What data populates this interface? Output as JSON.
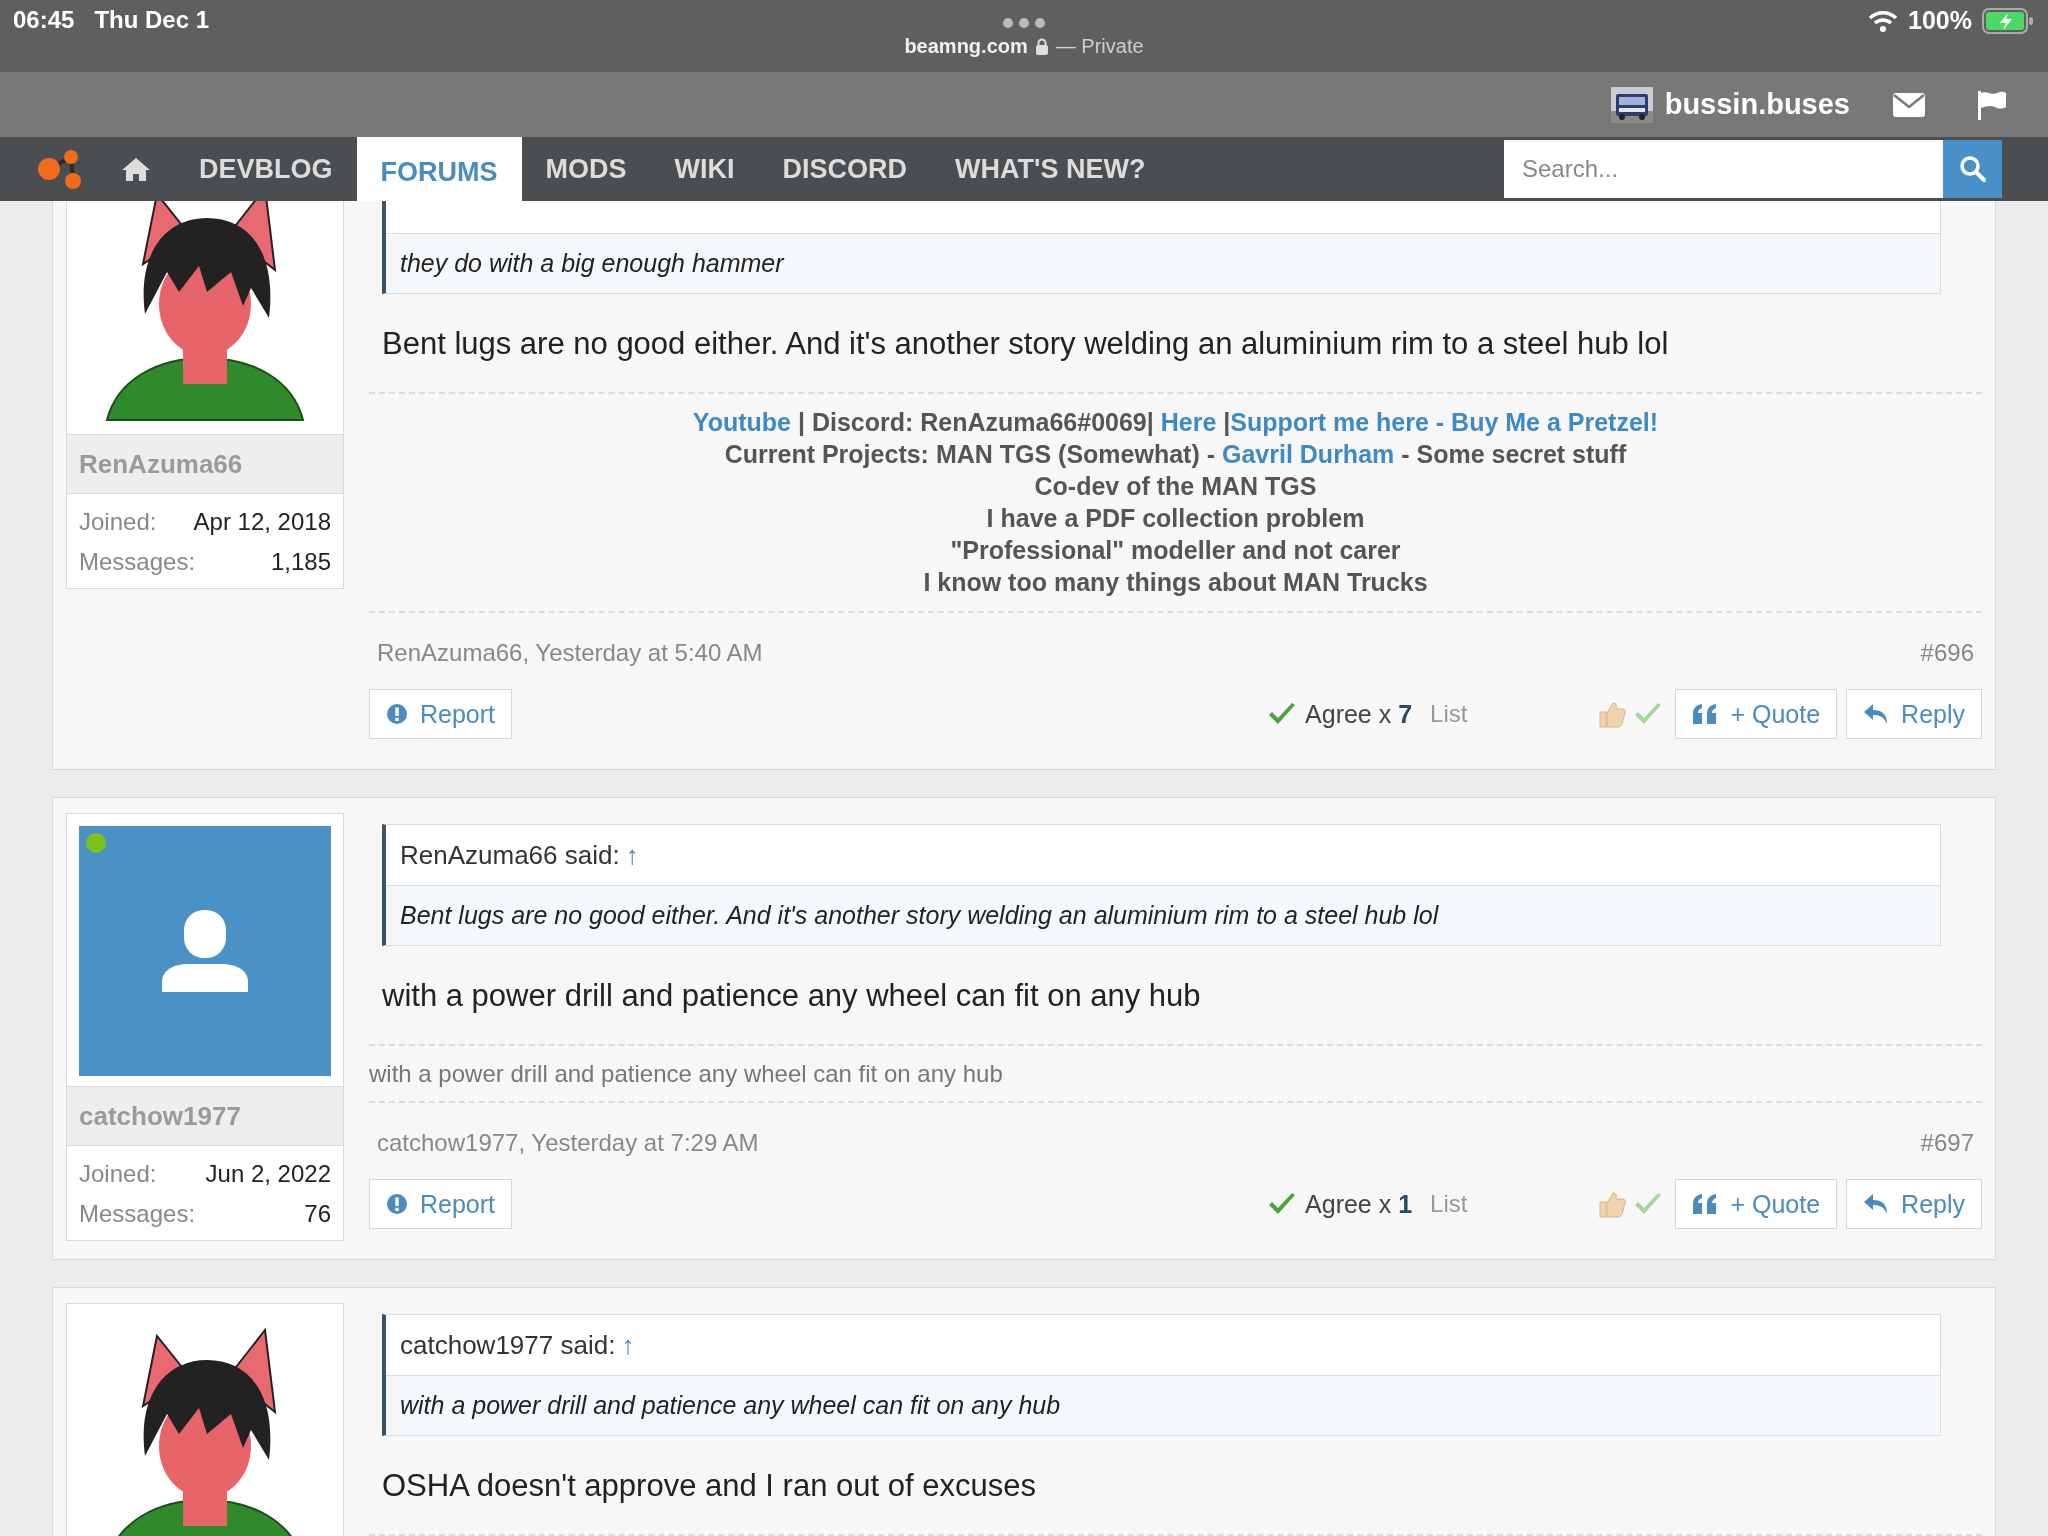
{
  "status_bar": {
    "time": "06:45",
    "date": "Thu Dec 1",
    "url": "beamng.com",
    "private_label": "— Private",
    "battery": "100%"
  },
  "user_bar": {
    "username": "bussin.buses"
  },
  "nav": {
    "items": [
      {
        "label": "DEVBLOG",
        "selected": false
      },
      {
        "label": "FORUMS",
        "selected": true
      },
      {
        "label": "MODS",
        "selected": false
      },
      {
        "label": "WIKI",
        "selected": false
      },
      {
        "label": "DISCORD",
        "selected": false
      },
      {
        "label": "WHAT'S NEW?",
        "selected": false
      }
    ],
    "search": {
      "placeholder": "Search..."
    }
  },
  "posts": [
    {
      "avatar": {
        "kind": "drawing"
      },
      "author": "RenAzuma66",
      "joined_label": "Joined:",
      "joined": "Apr 12, 2018",
      "messages_label": "Messages:",
      "messages": "1,185",
      "quote": {
        "text": "they do with a big enough hammer"
      },
      "body": "Bent lugs are no good either. And it's another story welding an aluminium rim to a steel hub lol",
      "signature": {
        "kind": "centered",
        "lines": [
          [
            {
              "kind": "link",
              "text": "Youtube"
            },
            {
              "kind": "text",
              "text": " | Discord: RenAzuma66#0069| "
            },
            {
              "kind": "link",
              "text": "Here"
            },
            {
              "kind": "text",
              "text": " |"
            },
            {
              "kind": "link",
              "text": "Support me here - Buy Me a Pretzel!"
            }
          ],
          [
            {
              "kind": "text",
              "text": "Current Projects: MAN TGS (Somewhat) - "
            },
            {
              "kind": "link",
              "text": "Gavril Durham"
            },
            {
              "kind": "text",
              "text": " - Some secret stuff"
            }
          ],
          [
            {
              "kind": "text",
              "text": "Co-dev of the MAN TGS"
            }
          ],
          [
            {
              "kind": "text",
              "text": "I have a PDF collection problem"
            }
          ],
          [
            {
              "kind": "text",
              "text": "\"Professional\" modeller and not carer"
            }
          ],
          [
            {
              "kind": "text",
              "text": "I know too many things about MAN Trucks"
            }
          ]
        ]
      },
      "meta": "RenAzuma66, Yesterday at 5:40 AM",
      "number": "#696",
      "report": "Report",
      "agree": "Agree x **7**",
      "list": "List",
      "quote_button": "+ Quote",
      "reply": "Reply"
    },
    {
      "avatar": {
        "kind": "default"
      },
      "online": true,
      "author": "catchow1977",
      "joined_label": "Joined:",
      "joined": "Jun 2, 2022",
      "messages_label": "Messages:",
      "messages": "76",
      "quote": {
        "author": "RenAzuma66 said:",
        "arrow": "↑",
        "text": "Bent lugs are no good either. And it's another story welding an aluminium rim to a steel hub lol"
      },
      "body": "with a power drill and patience any wheel can fit on any hub",
      "signature": {
        "kind": "plain",
        "lines": [
          [
            {
              "kind": "text",
              "text": "with a power drill and patience any wheel can fit on any hub"
            }
          ]
        ]
      },
      "meta": "catchow1977, Yesterday at 7:29 AM",
      "number": "#697",
      "report": "Report",
      "agree": "Agree x **1**",
      "list": "List",
      "quote_button": "+ Quote",
      "reply": "Reply"
    },
    {
      "avatar": {
        "kind": "drawing"
      },
      "quote": {
        "author": "catchow1977 said:",
        "arrow": "↑",
        "text": "with a power drill and patience any wheel can fit on any hub"
      },
      "body": "OSHA doesn't approve and I ran out of excuses"
    }
  ]
}
